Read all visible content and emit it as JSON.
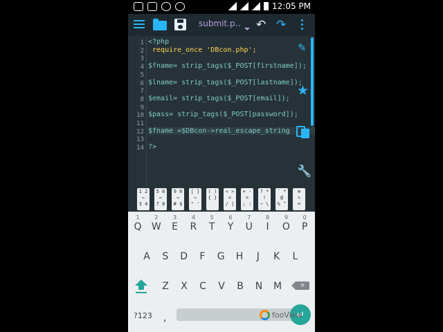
{
  "status_bar": {
    "time": "12:05 PM"
  },
  "toolbar": {
    "filename": "submit.p..",
    "undo_glyph": "↶",
    "redo_glyph": "↷"
  },
  "editor": {
    "line_numbers": [
      "1",
      "2",
      "3",
      "4",
      "5",
      "6",
      "7",
      "8",
      "9",
      "10",
      "11",
      "12",
      "13",
      "14"
    ],
    "lines": [
      "<?php",
      " require_once 'DBcon.php';",
      "",
      "$fname= strip_tags($_POST[firstname]);",
      "",
      "$lname= strip_tags($_POST[lastname]);",
      "",
      "$email= strip_tags($_POST[email]);",
      "",
      "$pass= strip_tags($_POST[password]);",
      "",
      "$fname =$DBcon->real_escape_string",
      "",
      "?>"
    ],
    "side_icons": {
      "wand": "✎",
      "star": "★",
      "wrench": "🔧"
    }
  },
  "symbol_bar": {
    "keys": [
      "1 2\n⇐\n3 4",
      "5 6\n⇐\n7 8",
      "9 0\n⇒\n# $",
      "[ ]\n⇒\n\" '",
      "( )\n{ }",
      "< >\n=\n/ |",
      "+ -\n=\n; :",
      "? *\n!\n~ \\",
      "` *\n@\n% ^",
      "⊗\n✎\n⌨"
    ]
  },
  "keyboard": {
    "row1": [
      "q",
      "w",
      "e",
      "r",
      "t",
      "y",
      "u",
      "i",
      "o",
      "p"
    ],
    "row1_hints": [
      "1",
      "2",
      "3",
      "4",
      "5",
      "6",
      "7",
      "8",
      "9",
      "0"
    ],
    "row2": [
      "a",
      "s",
      "d",
      "f",
      "g",
      "h",
      "j",
      "k",
      "l"
    ],
    "row3": [
      "z",
      "x",
      "c",
      "v",
      "b",
      "n",
      "m"
    ],
    "symbols_key": "?123",
    "comma": ",",
    "backspace_glyph": "×",
    "watermark": "fooView"
  },
  "colors": {
    "accent": "#29b6f6",
    "editor_bg": "#263238",
    "code_text": "#80cbc4",
    "keyword": "#ffd54f",
    "keyboard_bg": "#eceff1",
    "key_accent": "#26a69a"
  }
}
